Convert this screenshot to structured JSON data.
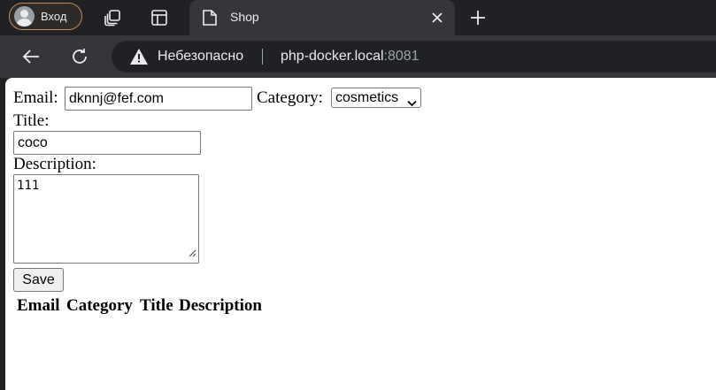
{
  "browser": {
    "profile_label": "Вход",
    "tab": {
      "title": "Shop"
    },
    "omnibox": {
      "security_label": "Небезопасно",
      "url_host": "php-docker.local",
      "url_port": ":8081"
    }
  },
  "form": {
    "email_label": "Email:",
    "email_value": "dknnj@fef.com",
    "category_label": "Category:",
    "category_selected": "cosmetics",
    "title_label": "Title:",
    "title_value": "coco",
    "description_label": "Description:",
    "description_value": "111",
    "save_label": "Save"
  },
  "table": {
    "headers": [
      "Email",
      "Category",
      "Title",
      "Description"
    ]
  }
}
